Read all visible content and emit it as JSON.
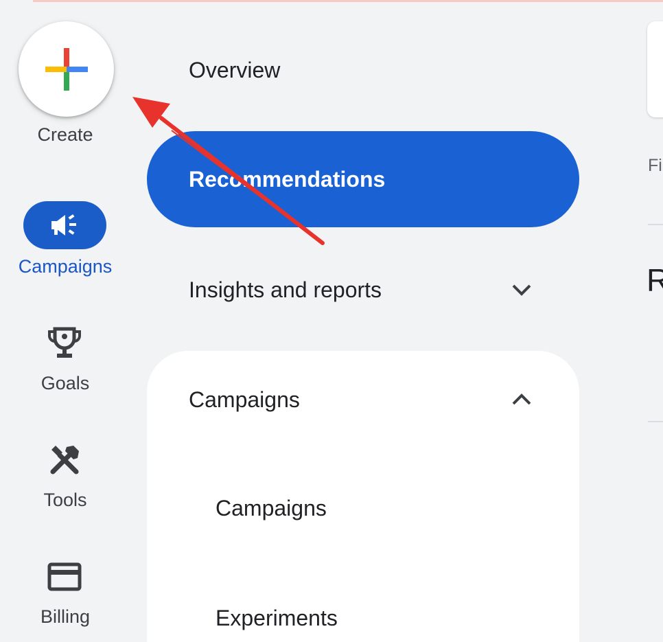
{
  "rail": {
    "create_label": "Create",
    "campaigns_label": "Campaigns",
    "goals_label": "Goals",
    "tools_label": "Tools",
    "billing_label": "Billing"
  },
  "nav": {
    "overview": "Overview",
    "recommendations": "Recommendations",
    "insights": "Insights and reports",
    "campaigns_section": "Campaigns",
    "campaigns_sub": "Campaigns",
    "experiments_sub": "Experiments"
  },
  "right": {
    "fi_text": "Fi",
    "r_text": "R"
  },
  "colors": {
    "accent_blue": "#1a62d3",
    "annotation_arrow": "#e8322c"
  }
}
